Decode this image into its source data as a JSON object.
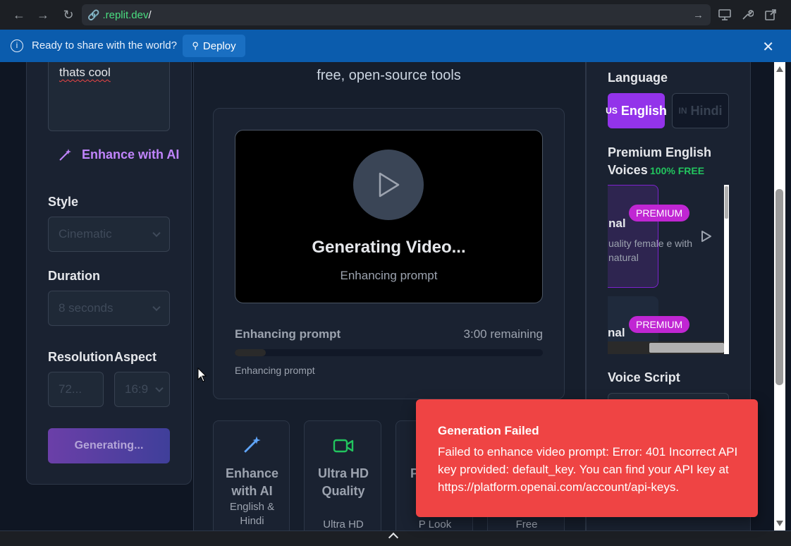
{
  "browser": {
    "url_host": ".replit.dev",
    "url_path": "/"
  },
  "banner": {
    "message": "Ready to share with the world?",
    "deploy_label": "Deploy"
  },
  "left": {
    "prompt_value": "thats cool",
    "enhance_label": "Enhance with AI",
    "style_label": "Style",
    "style_value": "Cinematic",
    "duration_label": "Duration",
    "duration_value": "8 seconds",
    "resolution_label": "Resolution",
    "resolution_value": "72...",
    "aspect_label": "Aspect",
    "aspect_value": "16:9",
    "generate_label": "Generating..."
  },
  "center": {
    "tagline": "free, open-source tools",
    "video_title": "Generating Video...",
    "video_status": "Enhancing prompt",
    "progress_label": "Enhancing prompt",
    "progress_remaining": "3:00 remaining",
    "progress_fraction": 0.1,
    "progress_sub": "Enhancing prompt"
  },
  "features": [
    {
      "title": "Enhance with AI",
      "sub": "English & Hindi",
      "icon": "magic-wand-icon"
    },
    {
      "title": "Ultra HD Quality",
      "sub": "Ultra HD",
      "icon": "video-camera-icon"
    },
    {
      "title": "P",
      "sub": "P Look",
      "icon": ""
    },
    {
      "title": "",
      "sub": "Free",
      "icon": ""
    }
  ],
  "right": {
    "language_label": "Language",
    "lang_english_code": "US",
    "lang_english": "English",
    "lang_hindi_code": "IN",
    "lang_hindi": "Hindi",
    "voices_title": "Premium English Voices",
    "voices_free": "100% FREE",
    "voice_cards": [
      {
        "name": "nal",
        "desc": "uality female e with natural",
        "badge": "PREMIUM"
      },
      {
        "name": "nal",
        "desc": "",
        "badge": "PREMIUM"
      }
    ],
    "script_label": "Voice Script"
  },
  "toast": {
    "title": "Generation Failed",
    "message": "Failed to enhance video prompt: Error: 401 Incorrect API key provided: default_key. You can find your API key at https://platform.openai.com/account/api-keys."
  },
  "colors": {
    "accent_purple": "#9333ea",
    "premium_pink": "#c026d3",
    "free_green": "#22c55e",
    "toast_red": "#ef4444",
    "banner_blue": "#0b5cad"
  }
}
